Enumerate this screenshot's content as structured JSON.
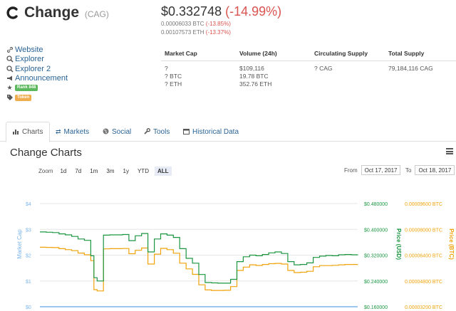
{
  "coin": {
    "name": "Change",
    "symbol": "(CAG)"
  },
  "links": [
    {
      "label": "Website",
      "icon": "link-icon"
    },
    {
      "label": "Explorer",
      "icon": "search-icon"
    },
    {
      "label": "Explorer 2",
      "icon": "search-icon"
    },
    {
      "label": "Announcement",
      "icon": "bullhorn-icon"
    }
  ],
  "badges": {
    "rank": "Rank 848",
    "token": "Token"
  },
  "price": {
    "usd": "$0.332748",
    "usd_change": "(-14.99%)",
    "btc": "0.00006033 BTC",
    "btc_change": "(-13.85%)",
    "eth": "0.00107573 ETH",
    "eth_change": "(-13.37%)"
  },
  "market_table": {
    "headers": [
      "Market Cap",
      "Volume (24h)",
      "Circulating Supply",
      "Total Supply"
    ],
    "rows": [
      [
        "?",
        "$109,116",
        "? CAG",
        "79,184,116 CAG"
      ],
      [
        "? BTC",
        "19.78 BTC",
        "",
        ""
      ],
      [
        "? ETH",
        "352.76 ETH",
        "",
        ""
      ]
    ]
  },
  "tabs": [
    {
      "label": "Charts",
      "icon": "bar-chart-icon",
      "active": true
    },
    {
      "label": "Markets",
      "icon": "exchange-icon",
      "active": false
    },
    {
      "label": "Social",
      "icon": "globe-icon",
      "active": false
    },
    {
      "label": "Tools",
      "icon": "wrench-icon",
      "active": false
    },
    {
      "label": "Historical Data",
      "icon": "calendar-icon",
      "active": false
    }
  ],
  "chart_panel": {
    "title": "Change Charts",
    "zoom_label": "Zoom",
    "zoom_options": [
      "1d",
      "7d",
      "1m",
      "3m",
      "1y",
      "YTD",
      "ALL"
    ],
    "zoom_selected": "ALL",
    "from_label": "From",
    "from_date": "Oct 17, 2017",
    "to_label": "To",
    "to_date": "Oct 18, 2017"
  },
  "colors": {
    "usd": "#1a9641",
    "btc": "#f0a30a",
    "market_cap": "#7cb5ec",
    "accent": "#2a6496"
  },
  "chart_data": {
    "type": "line",
    "axes": {
      "left": {
        "label": "Market Cap",
        "ticks": [
          "$4",
          "$3",
          "$2",
          "$1",
          "$0"
        ],
        "range": [
          0,
          4
        ]
      },
      "right_usd": {
        "label": "Price (USD)",
        "ticks": [
          "$0.480000",
          "$0.400000",
          "$0.320000",
          "$0.240000",
          "$0.160000"
        ],
        "range": [
          0.16,
          0.48
        ]
      },
      "right_btc": {
        "label": "Price (BTC)",
        "ticks": [
          "0.00009600 BTC",
          "0.00008000 BTC",
          "0.00006400 BTC",
          "0.00004800 BTC",
          "0.00003200 BTC"
        ],
        "range": [
          3.2e-05,
          9.6e-05
        ]
      }
    },
    "x": [
      0,
      2,
      4,
      6,
      8,
      10,
      12,
      14,
      16,
      17,
      18,
      20,
      22,
      24,
      26,
      28,
      30,
      32,
      34,
      36,
      38,
      40,
      42,
      44,
      46,
      48,
      50,
      52,
      54,
      56,
      58,
      60,
      62,
      64,
      66,
      68,
      70,
      72,
      74,
      76,
      78,
      80,
      82,
      84,
      86,
      88,
      90,
      92,
      94,
      96,
      98,
      100
    ],
    "series": [
      {
        "name": "Price (USD)",
        "axis": "right_usd",
        "values": [
          0.392,
          0.391,
          0.39,
          0.386,
          0.383,
          0.378,
          0.37,
          0.366,
          0.318,
          0.25,
          0.24,
          0.382,
          0.383,
          0.383,
          0.384,
          0.365,
          0.38,
          0.387,
          0.33,
          0.37,
          0.386,
          0.382,
          0.375,
          0.34,
          0.31,
          0.295,
          0.26,
          0.235,
          0.234,
          0.233,
          0.233,
          0.245,
          0.3,
          0.315,
          0.32,
          0.318,
          0.322,
          0.327,
          0.33,
          0.325,
          0.3,
          0.29,
          0.291,
          0.296,
          0.313,
          0.317,
          0.319,
          0.318,
          0.321,
          0.322,
          0.321,
          0.322
        ]
      },
      {
        "name": "Price (BTC)",
        "axis": "right_btc",
        "values": [
          6.89e-05,
          6.88e-05,
          6.87e-05,
          6.8e-05,
          6.74e-05,
          6.68e-05,
          6.53e-05,
          6.42e-05,
          6.06e-05,
          4.26e-05,
          4.18e-05,
          6.79e-05,
          6.8e-05,
          6.8e-05,
          6.81e-05,
          6.49e-05,
          6.7e-05,
          6.84e-05,
          5.85e-05,
          6.46e-05,
          6.82e-05,
          6.74e-05,
          6.52e-05,
          5.9e-05,
          5.55e-05,
          5.21e-05,
          4.56e-05,
          4.24e-05,
          4.21e-05,
          4.21e-05,
          4.22e-05,
          4.45e-05,
          5.45e-05,
          5.66e-05,
          5.8e-05,
          5.76e-05,
          5.82e-05,
          5.87e-05,
          5.89e-05,
          5.85e-05,
          5.45e-05,
          5.32e-05,
          5.34e-05,
          5.4e-05,
          5.68e-05,
          5.75e-05,
          5.75e-05,
          5.77e-05,
          5.8e-05,
          5.82e-05,
          5.82e-05,
          5.83e-05
        ]
      },
      {
        "name": "Market Cap",
        "axis": "left",
        "values": [
          0,
          0,
          0,
          0,
          0,
          0,
          0,
          0,
          0,
          0,
          0,
          0,
          0,
          0,
          0,
          0,
          0,
          0,
          0,
          0,
          0,
          0,
          0,
          0,
          0,
          0,
          0,
          0,
          0,
          0,
          0,
          0,
          0,
          0,
          0,
          0,
          0,
          0,
          0,
          0,
          0,
          0,
          0,
          0,
          0,
          0,
          0,
          0,
          0,
          0,
          0,
          0
        ]
      }
    ],
    "grid": true,
    "legend": "none"
  }
}
